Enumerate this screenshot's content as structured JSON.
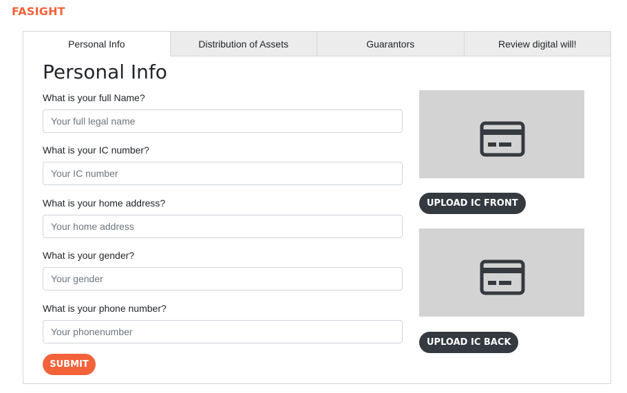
{
  "brand": "FASIGHT",
  "tabs": [
    {
      "label": "Personal Info",
      "active": true
    },
    {
      "label": "Distribution of Assets",
      "active": false
    },
    {
      "label": "Guarantors",
      "active": false
    },
    {
      "label": "Review digital will!",
      "active": false
    }
  ],
  "form": {
    "title": "Personal Info",
    "fields": [
      {
        "label": "What is your full Name?",
        "placeholder": "Your full legal name",
        "value": ""
      },
      {
        "label": "What is your IC number?",
        "placeholder": "Your IC number",
        "value": ""
      },
      {
        "label": "What is your home address?",
        "placeholder": "Your home address",
        "value": ""
      },
      {
        "label": "What is your gender?",
        "placeholder": "Your gender",
        "value": ""
      },
      {
        "label": "What is your phone number?",
        "placeholder": "Your phonenumber",
        "value": ""
      }
    ],
    "submit_label": "SUBMIT"
  },
  "uploads": {
    "front": {
      "label": "UPLOAD IC FRONT",
      "icon": "id-card-icon"
    },
    "back": {
      "label": "UPLOAD IC BACK",
      "icon": "id-card-icon"
    }
  },
  "colors": {
    "brand": "#f4623a",
    "submit": "#f4623a",
    "upload_button": "#343a40",
    "ic_placeholder": "#d3d3d3",
    "tab_inactive": "#ececec"
  }
}
